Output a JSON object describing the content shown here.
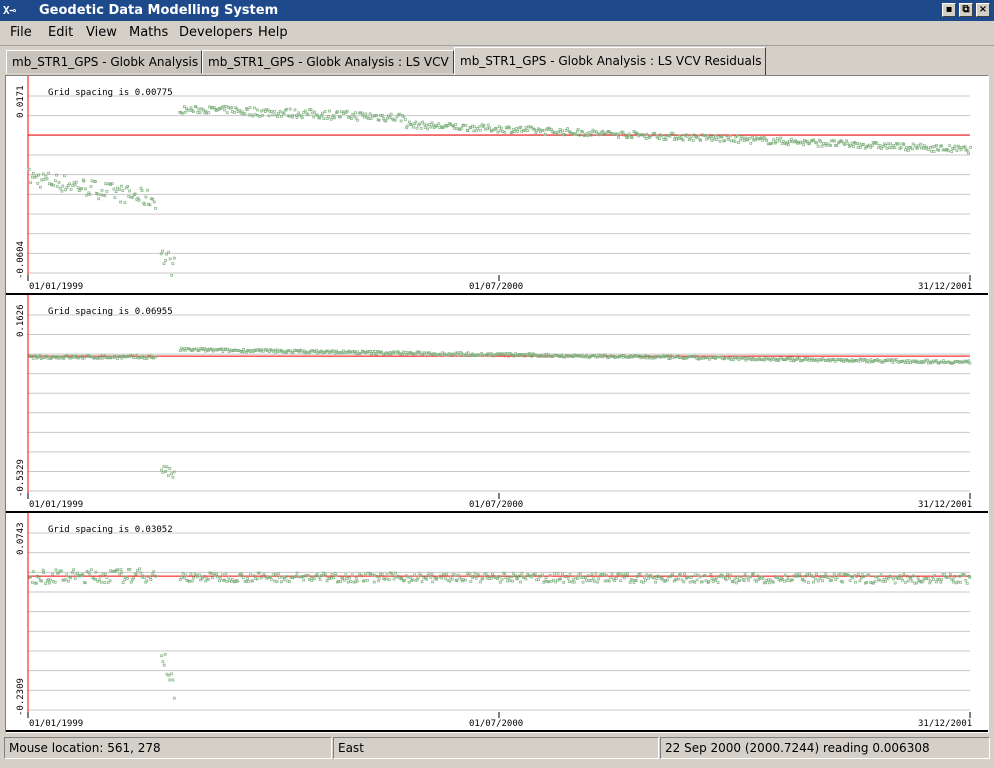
{
  "window": {
    "title": "Geodetic Data Modelling System",
    "logo": "X⊸",
    "controls": [
      {
        "name": "minimize-button",
        "glyph": "▪"
      },
      {
        "name": "maximize-button",
        "glyph": "⧉"
      },
      {
        "name": "close-button",
        "glyph": "×"
      }
    ]
  },
  "menu": [
    "File",
    "Edit",
    "View",
    "Maths",
    "Developers",
    "Help"
  ],
  "tabs": [
    {
      "label": "mb_STR1_GPS - Globk Analysis",
      "active": false
    },
    {
      "label": "mb_STR1_GPS - Globk Analysis : LS VCV",
      "active": false
    },
    {
      "label": "mb_STR1_GPS - Globk Analysis : LS VCV Residuals",
      "active": true
    }
  ],
  "colors": {
    "points": "#7fb07f",
    "reference_line": "#ff0000",
    "axis": "#ff0000",
    "grid": "#c8c8c8"
  },
  "chart_data": [
    {
      "type": "scatter",
      "grid_label": "Grid spacing is 0.00775",
      "y_top_label": "0.0171",
      "y_bottom_label": "-0.0604",
      "x_tick_labels": [
        "01/01/1999",
        "01/07/2000",
        "31/12/2001"
      ],
      "ylim": [
        -0.0604,
        0.0171
      ],
      "reference_value": 0.0,
      "series": [
        {
          "segments": [
            {
              "t0": 0.0,
              "t1": 0.135,
              "v0": -0.018,
              "v1": -0.028,
              "spread": 0.004
            },
            {
              "t0": 0.14,
              "t1": 0.155,
              "v0": -0.052,
              "v1": -0.058,
              "spread": 0.005
            },
            {
              "t0": 0.16,
              "t1": 0.22,
              "v0": 0.0115,
              "v1": 0.0115,
              "spread": 0.0015
            },
            {
              "t0": 0.22,
              "t1": 0.4,
              "v0": 0.011,
              "v1": 0.008,
              "spread": 0.002
            },
            {
              "t0": 0.4,
              "t1": 1.0,
              "v0": 0.005,
              "v1": -0.006,
              "spread": 0.0015
            }
          ]
        }
      ]
    },
    {
      "type": "scatter",
      "grid_label": "Grid spacing is 0.06955",
      "y_top_label": "0.1626",
      "y_bottom_label": "-0.5329",
      "x_tick_labels": [
        "01/01/1999",
        "01/07/2000",
        "31/12/2001"
      ],
      "ylim": [
        -0.5329,
        0.1626
      ],
      "reference_value": 0.0,
      "series": [
        {
          "segments": [
            {
              "t0": 0.0,
              "t1": 0.135,
              "v0": 0.0,
              "v1": 0.0,
              "spread": 0.006
            },
            {
              "t0": 0.14,
              "t1": 0.155,
              "v0": -0.44,
              "v1": -0.47,
              "spread": 0.02
            },
            {
              "t0": 0.16,
              "t1": 1.0,
              "v0": 0.03,
              "v1": -0.02,
              "spread": 0.006
            }
          ]
        }
      ]
    },
    {
      "type": "scatter",
      "grid_label": "Grid spacing is 0.03052",
      "y_top_label": "0.0743",
      "y_bottom_label": "-0.2309",
      "x_tick_labels": [
        "01/01/1999",
        "01/07/2000",
        "31/12/2001"
      ],
      "ylim": [
        -0.2309,
        0.0743
      ],
      "reference_value": 0.0,
      "series": [
        {
          "segments": [
            {
              "t0": 0.0,
              "t1": 0.135,
              "v0": 0.0,
              "v1": 0.003,
              "spread": 0.012
            },
            {
              "t0": 0.14,
              "t1": 0.155,
              "v0": -0.12,
              "v1": -0.21,
              "spread": 0.02
            },
            {
              "t0": 0.16,
              "t1": 1.0,
              "v0": 0.0,
              "v1": -0.003,
              "spread": 0.008
            }
          ]
        }
      ]
    }
  ],
  "status": {
    "mouse": "Mouse location: 561, 278",
    "component": "East",
    "reading": "22 Sep 2000 (2000.7244) reading 0.006308"
  }
}
